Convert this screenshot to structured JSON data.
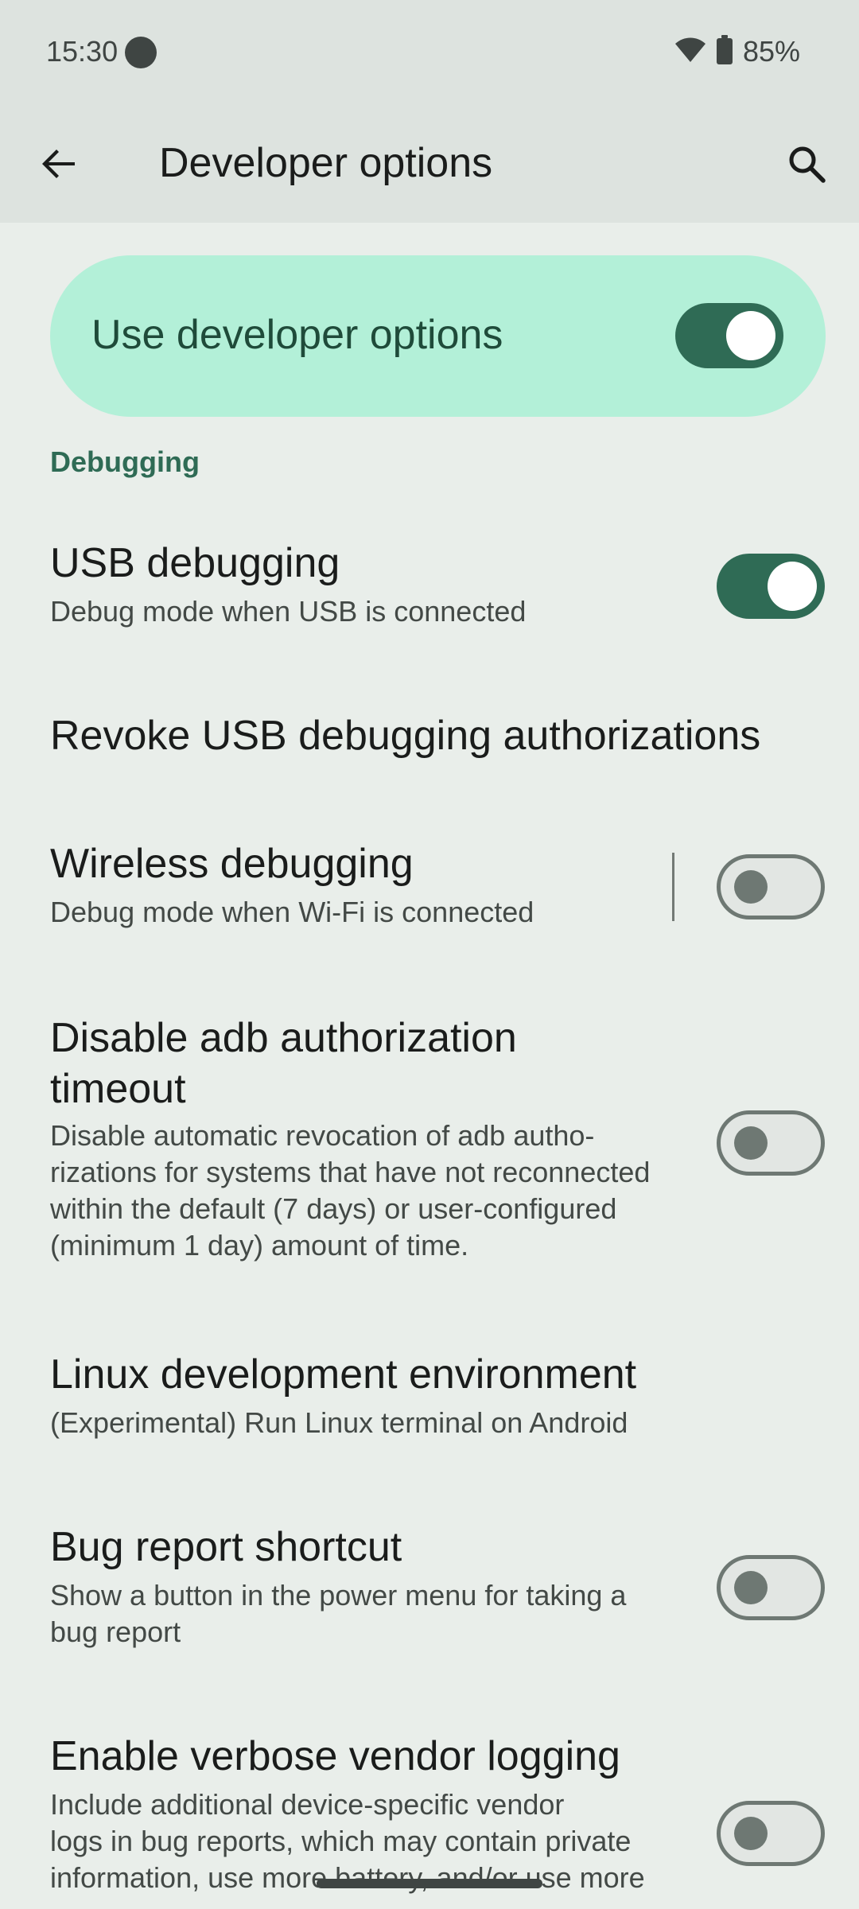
{
  "status_bar": {
    "time": "15:30",
    "battery": "85%",
    "icons": [
      "notification-dot-icon",
      "wifi-icon",
      "battery-icon"
    ]
  },
  "app_bar": {
    "title": "Developer options",
    "back_icon": "arrow-back-icon",
    "search_icon": "search-icon"
  },
  "main_switch": {
    "label": "Use developer options",
    "enabled": true
  },
  "sections": [
    {
      "header": "Debugging"
    }
  ],
  "preferences": [
    {
      "title": "USB debugging",
      "summary": "Debug mode when USB is connected",
      "switch": true
    },
    {
      "title": "Revoke USB debugging authorizations"
    },
    {
      "title": "Wireless debugging",
      "summary": "Debug mode when Wi-Fi is connected",
      "switch": false
    },
    {
      "title_line1": "Disable adb authorization",
      "title_line2": "timeout",
      "summary_lines": [
        "Disable automatic revocation of adb autho-",
        "rizations for systems that have not reconnected",
        "within the default (7 days) or user-configured",
        "(minimum 1 day) amount of time."
      ],
      "switch": false
    },
    {
      "title": "Linux development environment",
      "summary": "(Experimental) Run Linux terminal on Android"
    },
    {
      "title": "Bug report shortcut",
      "summary_lines": [
        "Show a button in the power menu for taking a",
        "bug report"
      ],
      "switch": false
    },
    {
      "title": "Enable verbose vendor logging",
      "summary_lines": [
        "Include additional device-specific vendor",
        "logs in bug reports, which may contain private",
        "information, use more battery, and/or use more"
      ],
      "switch": false
    }
  ],
  "colors": {
    "background": "#e9eeea",
    "app_bar": "#dde3df",
    "accent": "#2f6b55",
    "main_card": "#b3f0d8"
  }
}
